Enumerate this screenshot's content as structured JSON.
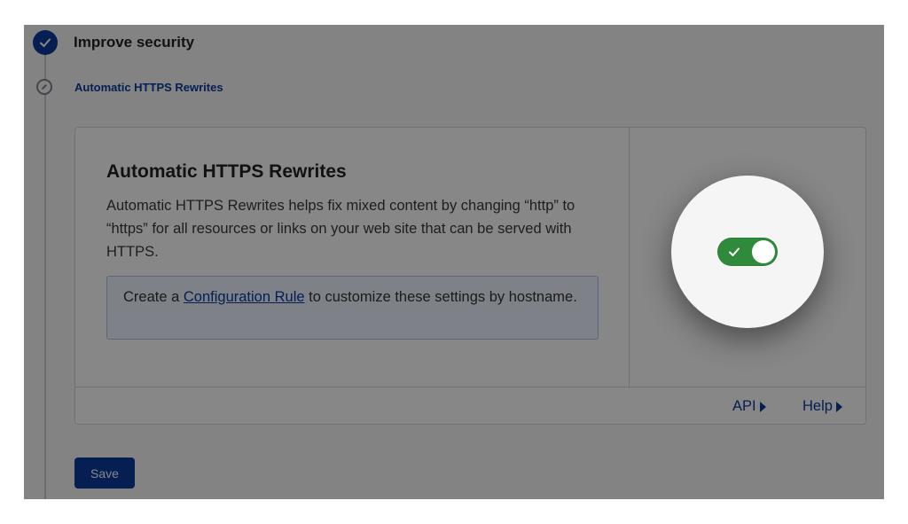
{
  "stepper": {
    "step_title": "Improve security",
    "substep_label": "Automatic HTTPS Rewrites"
  },
  "card": {
    "title": "Automatic HTTPS Rewrites",
    "description": "Automatic HTTPS Rewrites helps fix mixed content by changing “http” to “https” for all resources or links on your web site that can be served with HTTPS.",
    "note": {
      "prefix": "Create a ",
      "link_text": "Configuration Rule",
      "suffix": " to customize these settings by hostname."
    },
    "footer": {
      "api_label": "API",
      "help_label": "Help"
    }
  },
  "toggle": {
    "state": "on"
  },
  "save_button": {
    "label": "Save"
  },
  "colors": {
    "accent": "#0b3b9e",
    "toggle_on": "#2f8a3c",
    "overlay": "rgba(0,0,0,0.47)"
  }
}
